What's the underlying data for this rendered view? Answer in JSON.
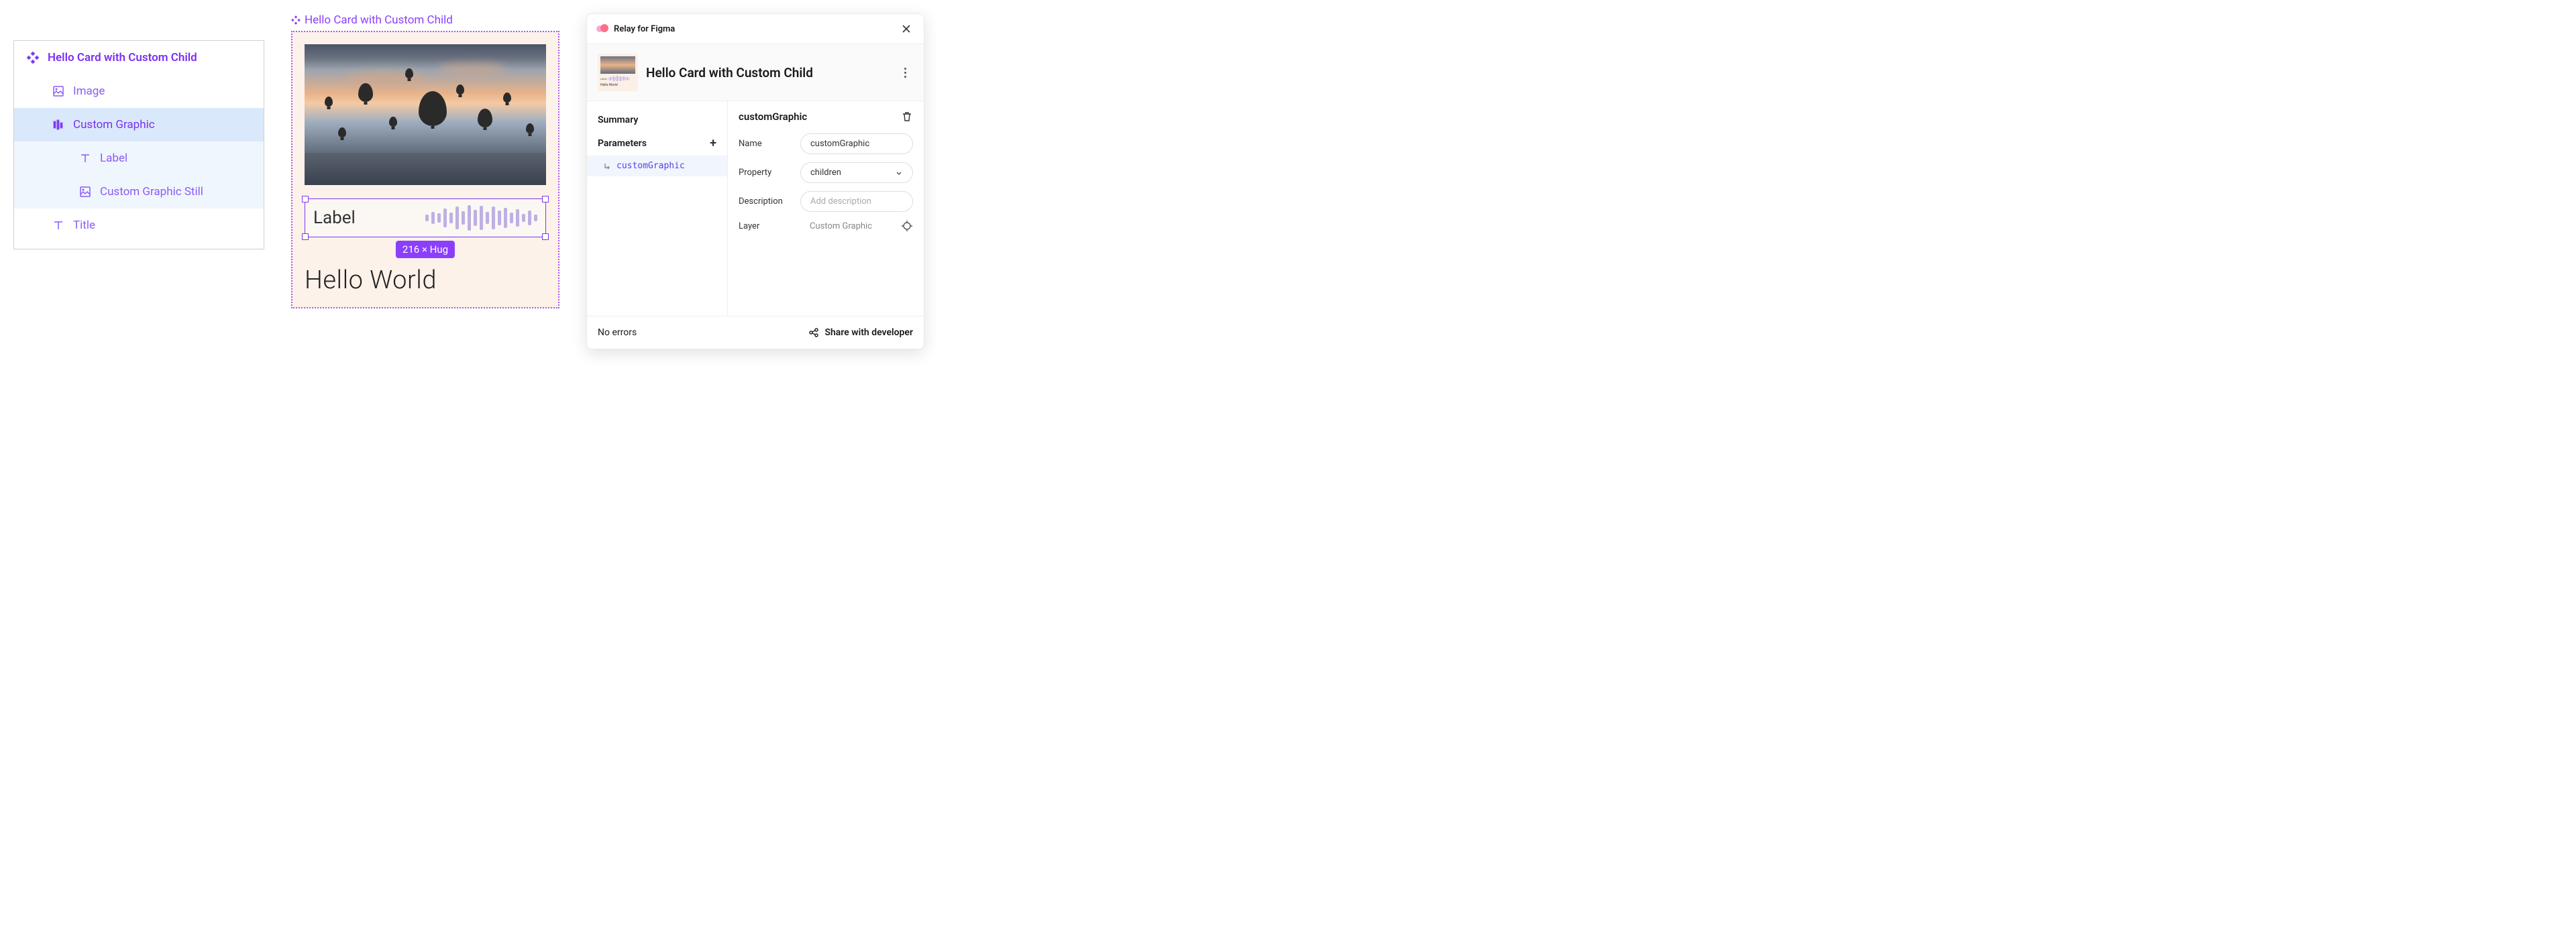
{
  "layers": {
    "root": "Hello Card with Custom Child",
    "image": "Image",
    "frame": "Custom Graphic",
    "child1": "Label",
    "child2": "Custom Graphic Still",
    "title": "Title"
  },
  "canvas": {
    "component_label": "Hello Card with Custom Child",
    "frame_label": "Label",
    "title_text": "Hello World",
    "size_badge": "216 × Hug",
    "eq_heights": [
      10,
      18,
      14,
      28,
      16,
      34,
      20,
      38,
      24,
      36,
      18,
      34,
      22,
      30,
      16,
      26,
      12,
      22,
      10
    ]
  },
  "plugin": {
    "brand": "Relay for Figma",
    "component_name": "Hello Card with Custom Child",
    "thumb": {
      "label": "Label",
      "title": "Hello World",
      "eq": [
        3,
        5,
        4,
        7,
        5,
        8,
        6,
        7,
        5,
        6,
        4,
        5,
        3
      ]
    },
    "left": {
      "summary": "Summary",
      "parameters": "Parameters",
      "param_item": "customGraphic"
    },
    "right": {
      "heading": "customGraphic",
      "name_label": "Name",
      "name_value": "customGraphic",
      "property_label": "Property",
      "property_value": "children",
      "description_label": "Description",
      "description_placeholder": "Add description",
      "layer_label": "Layer",
      "layer_value": "Custom Graphic"
    },
    "footer": {
      "status": "No errors",
      "share": "Share with developer"
    }
  }
}
